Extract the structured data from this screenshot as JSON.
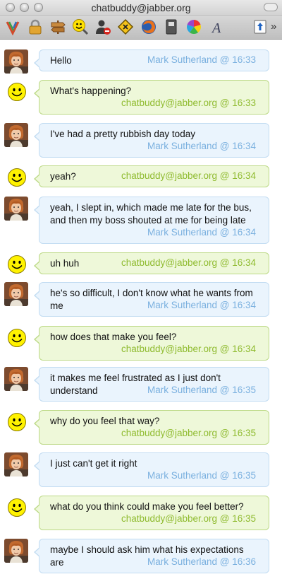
{
  "window": {
    "title": "chatbuddy@jabber.org"
  },
  "toolbar": {
    "icons": [
      "pencil-icon",
      "lock-icon",
      "signpost-icon",
      "search-smiley-icon",
      "user-block-icon",
      "warning-icon",
      "firefox-icon",
      "notebook-icon",
      "color-wheel-icon",
      "font-icon",
      "send-file-icon"
    ],
    "overflow": "»"
  },
  "colors": {
    "self_meta": "#7ab0df",
    "buddy_meta": "#8fbb2f",
    "self_bubble": "#eaf4fd",
    "buddy_bubble": "#eef8d9"
  },
  "messages": [
    {
      "sender": "Mark Sutherland",
      "time": "16:33",
      "meta": "Mark Sutherland @ 16:33",
      "text": "Hello"
    },
    {
      "sender": "chatbuddy@jabber.org",
      "time": "16:33",
      "meta": "chatbuddy@jabber.org @ 16:33",
      "text": "What's happening?"
    },
    {
      "sender": "Mark Sutherland",
      "time": "16:34",
      "meta": "Mark Sutherland @ 16:34",
      "text": "I've had a pretty rubbish day today"
    },
    {
      "sender": "chatbuddy@jabber.org",
      "time": "16:34",
      "meta": "chatbuddy@jabber.org @ 16:34",
      "text": "yeah?"
    },
    {
      "sender": "Mark Sutherland",
      "time": "16:34",
      "meta": "Mark Sutherland @ 16:34",
      "text": "yeah, I slept in, which made me late for the bus, and then my boss shouted at me for being late"
    },
    {
      "sender": "chatbuddy@jabber.org",
      "time": "16:34",
      "meta": "chatbuddy@jabber.org @ 16:34",
      "text": "uh huh"
    },
    {
      "sender": "Mark Sutherland",
      "time": "16:34",
      "meta": "Mark Sutherland @ 16:34",
      "text": "he's so difficult, I don't know what he wants from me"
    },
    {
      "sender": "chatbuddy@jabber.org",
      "time": "16:34",
      "meta": "chatbuddy@jabber.org @ 16:34",
      "text": "how does that make you feel?"
    },
    {
      "sender": "Mark Sutherland",
      "time": "16:35",
      "meta": "Mark Sutherland @ 16:35",
      "text": "it makes me feel frustrated as I just don't understand"
    },
    {
      "sender": "chatbuddy@jabber.org",
      "time": "16:35",
      "meta": "chatbuddy@jabber.org @ 16:35",
      "text": "why do you feel that way?"
    },
    {
      "sender": "Mark Sutherland",
      "time": "16:35",
      "meta": "Mark Sutherland @ 16:35",
      "text": "I just can't get it right"
    },
    {
      "sender": "chatbuddy@jabber.org",
      "time": "16:35",
      "meta": "chatbuddy@jabber.org @ 16:35",
      "text": "what do you think could make you feel better?"
    },
    {
      "sender": "Mark Sutherland",
      "time": "16:36",
      "meta": "Mark Sutherland @ 16:36",
      "text": "maybe I should ask him what his expectations are"
    }
  ]
}
